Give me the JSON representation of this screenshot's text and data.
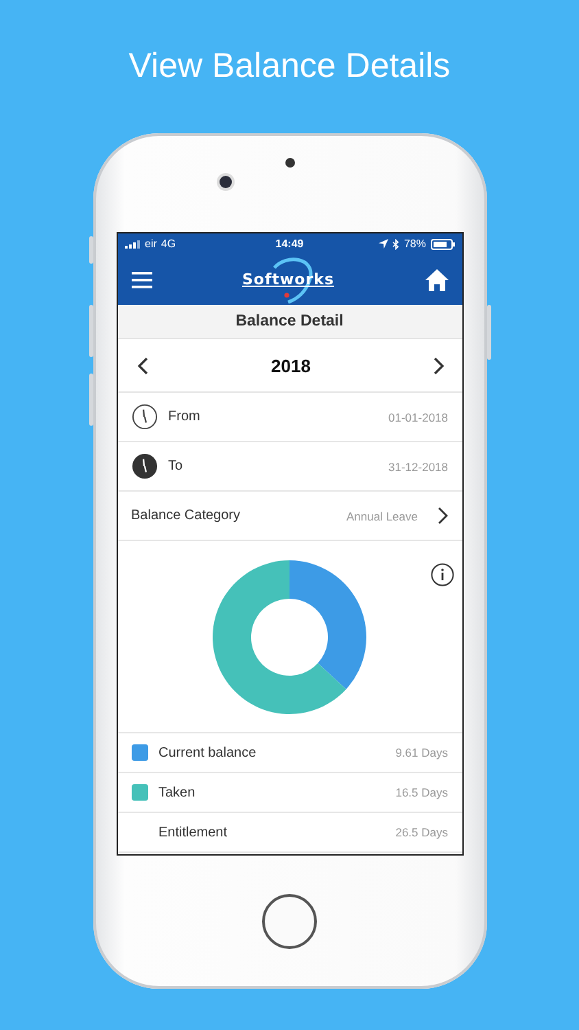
{
  "headline": "View Balance Details",
  "status_bar": {
    "carrier": "eir",
    "network": "4G",
    "time": "14:49",
    "battery": "78%"
  },
  "app_bar": {
    "logo": "Softworks"
  },
  "title": "Balance Detail",
  "year": "2018",
  "date_rows": [
    {
      "kind": "from",
      "label": "From",
      "value": "01-01-2018"
    },
    {
      "kind": "to",
      "label": "To",
      "value": "31-12-2018"
    }
  ],
  "category": {
    "label": "Balance Category",
    "value": "Annual Leave"
  },
  "chart": {
    "chart_data": {
      "type": "donut",
      "values": [
        36.8,
        63.2
      ]
    }
  },
  "legend": [
    {
      "label": "Current balance",
      "value": "9.61 Days",
      "color": "#3d9be6"
    },
    {
      "label": "Taken",
      "value": "16.5 Days",
      "color": "#45c1b9"
    },
    {
      "label": "Entitlement",
      "value": "26.5 Days"
    }
  ]
}
